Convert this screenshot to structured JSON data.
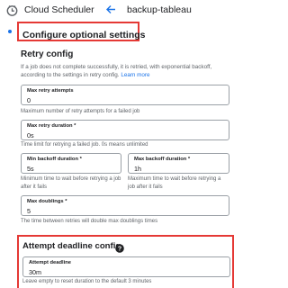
{
  "header": {
    "app_title": "Cloud Scheduler",
    "job_name": "backup-tableau"
  },
  "section": {
    "title": "Configure optional settings"
  },
  "retry": {
    "title": "Retry config",
    "description": "If a job does not complete successfully, it is retried, with exponential backoff, according to the settings in retry config.",
    "learn_more": "Learn more",
    "max_retry_attempts": {
      "label": "Max retry attempts",
      "value": "0",
      "hint": "Maximum number of retry attempts for a failed job"
    },
    "max_retry_duration": {
      "label": "Max retry duration *",
      "value": "0s",
      "hint": "Time limit for retrying a failed job. 0s means unlimited"
    },
    "min_backoff": {
      "label": "Min backoff duration *",
      "value": "5s",
      "hint": "Minimum time to wait before retrying a job after it fails"
    },
    "max_backoff": {
      "label": "Max backoff duration *",
      "value": "1h",
      "hint": "Maximum time to wait before retrying a job after it fails"
    },
    "max_doublings": {
      "label": "Max doublings *",
      "value": "5",
      "hint": "The time between retries will double max doublings times"
    }
  },
  "deadline": {
    "title": "Attempt deadline config",
    "field": {
      "label": "Attempt deadline",
      "value": "30m",
      "hint": "Leave empty to reset duration to the default 3 minutes"
    }
  },
  "colors": {
    "accent": "#1a73e8",
    "highlight_border": "#e53935"
  },
  "icons": {
    "logo": "cloud-scheduler-icon",
    "back": "arrow-back-icon",
    "help": "help-icon"
  }
}
